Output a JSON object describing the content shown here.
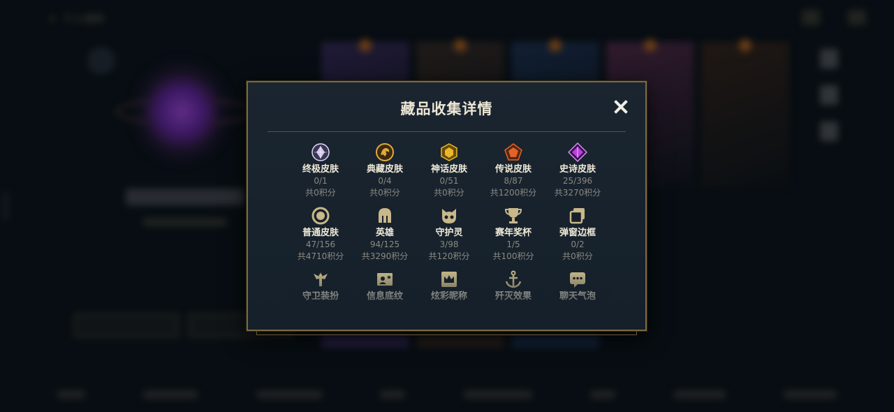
{
  "background": {
    "nav_title": "个人资料",
    "cards": [
      "#3b2a5c",
      "#3a2a22",
      "#1e3354",
      "#5a2a4a",
      "#3a2418"
    ],
    "bottom_nav_widths": [
      40,
      78,
      94,
      36,
      98,
      36,
      74,
      76
    ]
  },
  "modal": {
    "title": "藏品收集详情",
    "close_label": "关闭",
    "categories": [
      {
        "name": "终极皮肤",
        "count": "0/1",
        "points": "共0积分",
        "icon": "ultimate-skin-icon",
        "color": "#cfc6f0"
      },
      {
        "name": "典藏皮肤",
        "count": "0/4",
        "points": "共0积分",
        "icon": "prestige-skin-icon",
        "color": "#e1a93a"
      },
      {
        "name": "神话皮肤",
        "count": "0/51",
        "points": "共0积分",
        "icon": "mythic-skin-icon",
        "color": "#e8b82a"
      },
      {
        "name": "传说皮肤",
        "count": "8/87",
        "points": "共1200积分",
        "icon": "legendary-skin-icon",
        "color": "#e0642a"
      },
      {
        "name": "史诗皮肤",
        "count": "25/396",
        "points": "共3270积分",
        "icon": "epic-skin-icon",
        "color": "#b642d8"
      },
      {
        "name": "普通皮肤",
        "count": "47/156",
        "points": "共4710积分",
        "icon": "standard-skin-icon",
        "color": "#c8b88a"
      },
      {
        "name": "英雄",
        "count": "94/125",
        "points": "共3290积分",
        "icon": "champion-helmet-icon",
        "color": "#c8b88a"
      },
      {
        "name": "守护灵",
        "count": "3/98",
        "points": "共120积分",
        "icon": "guardian-spirit-icon",
        "color": "#c8b88a"
      },
      {
        "name": "赛年奖杯",
        "count": "1/5",
        "points": "共100积分",
        "icon": "season-trophy-icon",
        "color": "#c8b88a"
      },
      {
        "name": "弹窗边框",
        "count": "0/2",
        "points": "共0积分",
        "icon": "popup-frame-icon",
        "color": "#c8b88a"
      },
      {
        "name": "守卫装扮",
        "count": "",
        "points": "",
        "icon": "ward-skin-icon",
        "color": "#c8b88a"
      },
      {
        "name": "信息底纹",
        "count": "",
        "points": "",
        "icon": "info-banner-icon",
        "color": "#c8b88a"
      },
      {
        "name": "炫彩昵称",
        "count": "",
        "points": "",
        "icon": "crown-nickname-icon",
        "color": "#c8b88a"
      },
      {
        "name": "歼灭效果",
        "count": "",
        "points": "",
        "icon": "anchor-effect-icon",
        "color": "#c8b88a"
      },
      {
        "name": "聊天气泡",
        "count": "",
        "points": "",
        "icon": "chat-bubble-icon",
        "color": "#c8b88a"
      }
    ]
  }
}
